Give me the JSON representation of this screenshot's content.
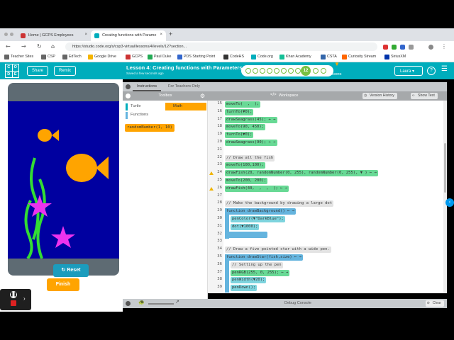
{
  "browser": {
    "tabs": [
      {
        "title": "Home | GCPS Employees",
        "active": false
      },
      {
        "title": "Creating functions with Parame",
        "active": true
      }
    ],
    "new_tab": "+",
    "url": "https://studio.code.org/s/csp3-virtual/lessons/4/levels/12?section...",
    "bookmarks": [
      "Teacher Sites",
      "CSP",
      "EdTech",
      "Google Drive",
      "GCPS",
      "Paul Duke",
      "PDS Starting Point",
      "CodeHS",
      "Code.org",
      "Khan Academy",
      "CSTA",
      "Curiosity Stream",
      "SiriusXM"
    ]
  },
  "header": {
    "logo_letters": [
      "C",
      "O",
      "D",
      "E"
    ],
    "share": "Share",
    "remix": "Remix",
    "lesson_title": "Lesson 4: Creating functions with Parameters",
    "saved": "Saved a few seconds ago",
    "current_level": "12",
    "more": "MORE",
    "user": "Laura"
  },
  "left": {
    "reset": "Reset",
    "finish": "Finish"
  },
  "tabs": {
    "instructions": "Instructions",
    "teachers": "For Teachers Only"
  },
  "toolbox": {
    "title": "Toolbox",
    "categories": [
      {
        "label": "Turtle",
        "color": "#00adbc"
      },
      {
        "label": "Math",
        "color": "#ffa400"
      },
      {
        "label": "Functions",
        "color": "#64b4de"
      }
    ],
    "block": "randomNumber(1, 10)"
  },
  "workspace": {
    "title": "Workspace",
    "version_history": "Version History",
    "show_text": "Show Text",
    "line_numbers": [
      "15",
      "16",
      "17",
      "18",
      "19",
      "20",
      "21",
      "22",
      "23",
      "24",
      "25",
      "26",
      "27",
      "28",
      "29",
      "30",
      "31",
      "32",
      "33",
      "34",
      "35",
      "36",
      "37",
      "38",
      "39"
    ],
    "lines": [
      {
        "text": "moveTo(  ,  );",
        "kind": "g",
        "indent": 0
      },
      {
        "text": "turnTo(▼0);",
        "kind": "g",
        "indent": 0
      },
      {
        "text": "drawSeagrass(45); ← →",
        "kind": "g",
        "indent": 0
      },
      {
        "text": "moveTo(90, 450);",
        "kind": "g",
        "indent": 0
      },
      {
        "text": "turnTo(▼0);",
        "kind": "g",
        "indent": 0
      },
      {
        "text": "drawSeagrass(90); ← →",
        "kind": "g",
        "indent": 0
      },
      {
        "text": "",
        "kind": "",
        "indent": 0
      },
      {
        "text": "// Draw all the fish",
        "kind": "cm",
        "indent": 0
      },
      {
        "text": "moveTo(100,100);",
        "kind": "g",
        "indent": 0
      },
      {
        "text": "drawFish(20, randomNumber(0, 255), randomNumber(0, 255), ▼ ) ← →",
        "kind": "g",
        "indent": 0
      },
      {
        "text": "moveTo(200, 200);",
        "kind": "g",
        "indent": 0
      },
      {
        "text": "drawFish(40,  ,  ,  ); ← →",
        "kind": "g",
        "indent": 0
      },
      {
        "text": "",
        "kind": "",
        "indent": 0
      },
      {
        "text": "// Make the background by drawing a large dot",
        "kind": "cm",
        "indent": 0
      },
      {
        "text": "function drawBackground() ← →",
        "kind": "b",
        "indent": 0
      },
      {
        "text": "penColor(▼\"DarkBlue\");",
        "kind": "t",
        "indent": 1
      },
      {
        "text": "dot(▼1000);",
        "kind": "t",
        "indent": 1
      },
      {
        "text": "",
        "kind": "b",
        "indent": 0
      },
      {
        "text": "",
        "kind": "",
        "indent": 0
      },
      {
        "text": "// Draw a five pointed star with a wide pen.",
        "kind": "cm",
        "indent": 0
      },
      {
        "text": "function drawStar(fish,size) ← →",
        "kind": "b",
        "indent": 0
      },
      {
        "text": "// Setting up the pen",
        "kind": "cm",
        "indent": 1
      },
      {
        "text": "penRGB(255, 0, 255); ← →",
        "kind": "g",
        "indent": 1
      },
      {
        "text": "penWidth(▼20);",
        "kind": "t",
        "indent": 1
      },
      {
        "text": "penDown();",
        "kind": "t",
        "indent": 1
      }
    ],
    "warn_lines": [
      "24",
      "26"
    ]
  },
  "debug": {
    "title": "Debug Console",
    "clear": "Clear"
  },
  "colors": {
    "brand": "#00adbc",
    "canvas_bg": "#0000a0",
    "fish": "#ffa400",
    "seagrass": "#33dd33",
    "star": "#ee33ee"
  }
}
